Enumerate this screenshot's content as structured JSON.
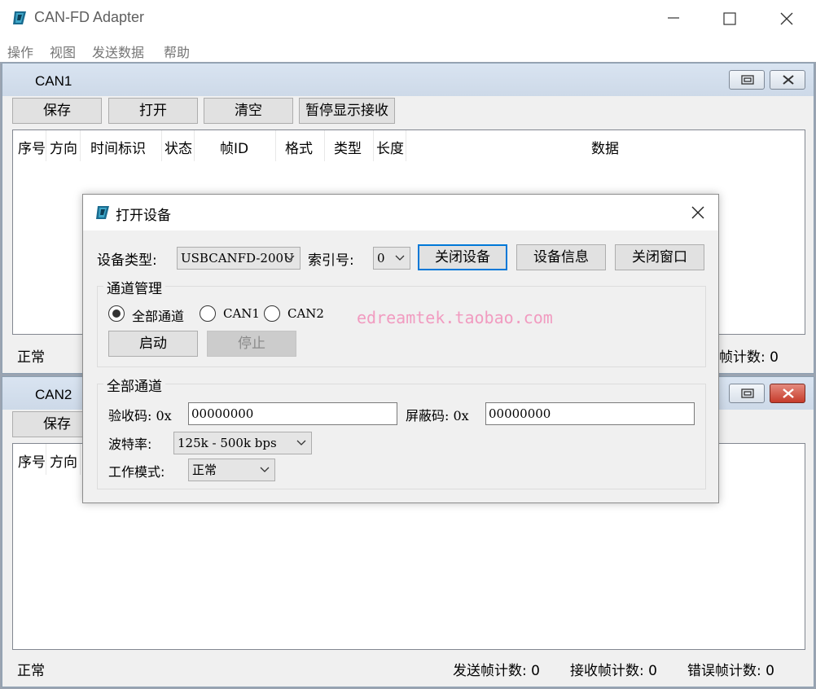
{
  "app": {
    "title": "CAN-FD  Adapter"
  },
  "menu": [
    "操作",
    "视图",
    "发送数据",
    "帮助"
  ],
  "columns": [
    "序号",
    "方向",
    "时间标识",
    "状态",
    "帧ID",
    "格式",
    "类型",
    "长度",
    "数据"
  ],
  "can1": {
    "title": "CAN1",
    "buttons": {
      "save": "保存",
      "open": "打开",
      "clear": "清空",
      "pause": "暂停显示接收"
    },
    "status": {
      "state": "正常",
      "rx_partial": "帧计数: 0"
    }
  },
  "can2": {
    "title": "CAN2",
    "buttons": {
      "save": "保存"
    },
    "status": {
      "state": "正常",
      "tx": "发送帧计数: 0",
      "rx": "接收帧计数: 0",
      "err": "错误帧计数: 0"
    }
  },
  "dialog": {
    "title": "打开设备",
    "device_type_label": "设备类型:",
    "device_type_value": "USBCANFD-200U",
    "index_label": "索引号:",
    "index_value": "0",
    "close_device": "关闭设备",
    "device_info": "设备信息",
    "close_window": "关闭窗口",
    "channel_group": "通道管理",
    "radio_all": "全部通道",
    "radio_can1": "CAN1",
    "radio_can2": "CAN2",
    "selected_channel": "全部通道",
    "start": "启动",
    "stop": "停止",
    "all_group": "全部通道",
    "accept_code_label": "验收码: 0x",
    "accept_code_value": "00000000",
    "mask_code_label": "屏蔽码: 0x",
    "mask_code_value": "00000000",
    "baud_label": "波特率:",
    "baud_value": "125k - 500k bps",
    "mode_label": "工作模式:",
    "mode_value": "正常",
    "watermark": "edreamtek.taobao.com"
  },
  "colors": {
    "accent": "#0078d7",
    "mdi_background": "#9aa4b1",
    "close_red": "#c63b2b",
    "watermark": "#f19bc0"
  }
}
